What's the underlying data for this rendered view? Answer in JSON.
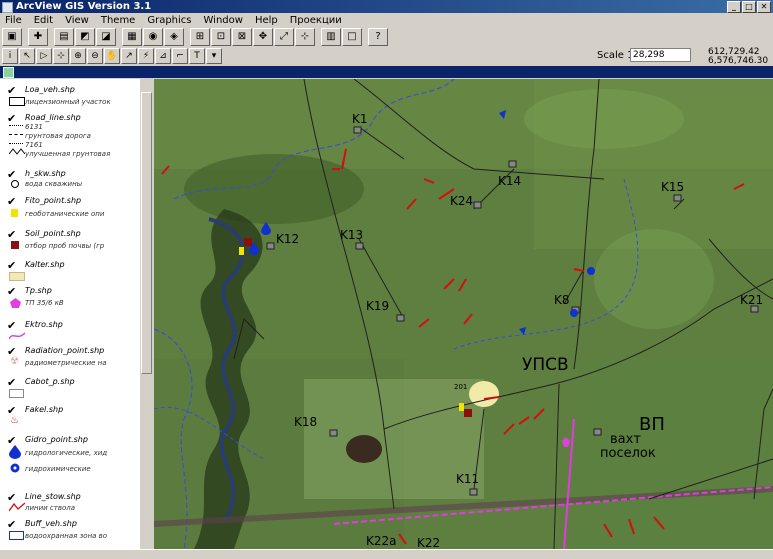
{
  "window": {
    "title": "ArcView GIS Version 3.1"
  },
  "menu": [
    "File",
    "Edit",
    "View",
    "Theme",
    "Graphics",
    "Window",
    "Help",
    "Проекции"
  ],
  "scale": {
    "label": "Scale 1:",
    "value": "28,298"
  },
  "coords": {
    "x": "612,729.42",
    "y": "6,576,746.30"
  },
  "themes": [
    {
      "name": "Loa_veh.shp",
      "legend": [
        "лицензионный участок"
      ]
    },
    {
      "name": "Road_line.shp",
      "legend": [
        "6131",
        "грунтовая дорога",
        "7161",
        "улучшенная грунтовая"
      ]
    },
    {
      "name": "h_skw.shp",
      "legend": [
        "вода скважины"
      ]
    },
    {
      "name": "Fito_point.shp",
      "legend": [
        "геоботанические опи"
      ]
    },
    {
      "name": "Soil_point.shp",
      "legend": [
        "отбор проб почвы (гр"
      ]
    },
    {
      "name": "Kalter.shp",
      "legend": []
    },
    {
      "name": "Tp.shp",
      "legend": [
        "ТП 35/6 кВ"
      ]
    },
    {
      "name": "Ektro.shp",
      "legend": []
    },
    {
      "name": "Radiation_point.shp",
      "legend": [
        "радиометрические на"
      ]
    },
    {
      "name": "Cabot_p.shp",
      "legend": []
    },
    {
      "name": "Fakel.shp",
      "legend": []
    },
    {
      "name": "Gidro_point.shp",
      "legend": [
        "гидрологические, хид",
        "гидрохимические"
      ]
    },
    {
      "name": "Line_stow.shp",
      "legend": [
        "линии ствола"
      ]
    },
    {
      "name": "Buff_veh.shp",
      "legend": [
        "водоохранная зона во"
      ]
    }
  ],
  "map_labels": [
    "K1",
    "K14",
    "K24",
    "K15",
    "K12",
    "K13",
    "K19",
    "K8",
    "K21",
    "УПСВ",
    "ВП",
    "вахт",
    "поселок",
    "K18",
    "K11",
    "K22a",
    "K22",
    "201"
  ],
  "colors": {
    "titlebar": "#0a246a",
    "map_bg": "#5a7a3c",
    "road": "#202020",
    "water_boundary": "#3a4cd8",
    "gas_line": "#e03ce0"
  }
}
